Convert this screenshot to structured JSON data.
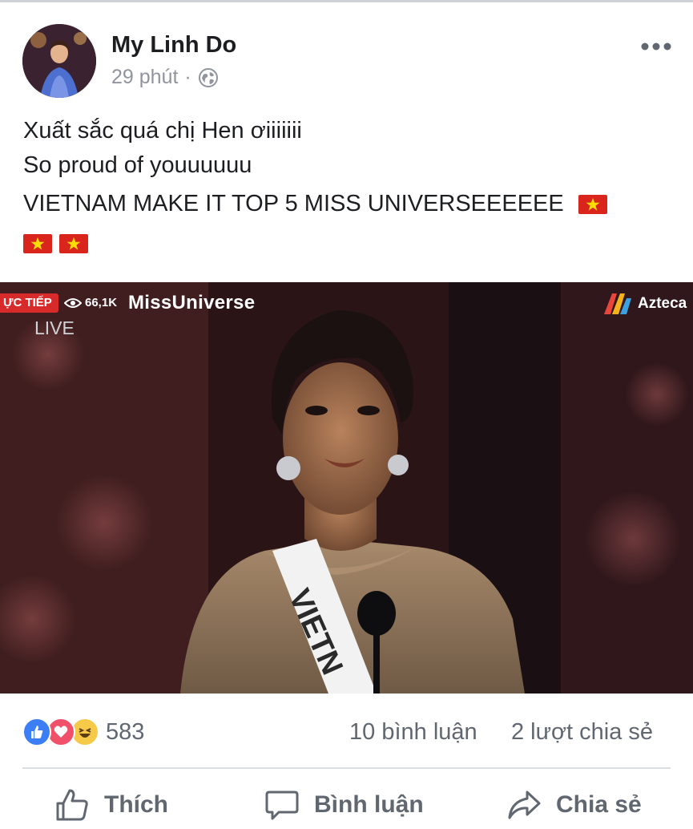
{
  "post": {
    "author_name": "My Linh Do",
    "timestamp": "29 phút",
    "separator": "·",
    "privacy_icon": "globe-icon",
    "more_icon": "more-icon",
    "text_lines": [
      "Xuất sắc quá chị Hen ơiiiiiii",
      "So proud of youuuuuu",
      "VIETNAM MAKE IT TOP 5 MISS UNIVERSEEEEEE"
    ],
    "flags_icon": "vietnam-flag-icon"
  },
  "media": {
    "live_badge": "ỰC TIẾP",
    "views": "66,1K",
    "channel": "MissUniverse",
    "live_label": "LIVE",
    "network": "Azteca",
    "sash_text": "VIETN"
  },
  "stats": {
    "reaction_icons": [
      "like-reaction-icon",
      "love-reaction-icon",
      "haha-reaction-icon"
    ],
    "reaction_count": "583",
    "comments": "10 bình luận",
    "shares": "2 lượt chia sẻ"
  },
  "actions": {
    "like_label": "Thích",
    "comment_label": "Bình luận",
    "share_label": "Chia sẻ"
  },
  "colors": {
    "name": "#1c1e21",
    "meta": "#90949c",
    "action": "#606770",
    "like_blue": "#3b7ef5",
    "love_red": "#f0506a",
    "haha_yellow": "#f7c948",
    "flag_red": "#da251d",
    "flag_star": "#ffdd00",
    "live_red": "#d72b2b"
  }
}
